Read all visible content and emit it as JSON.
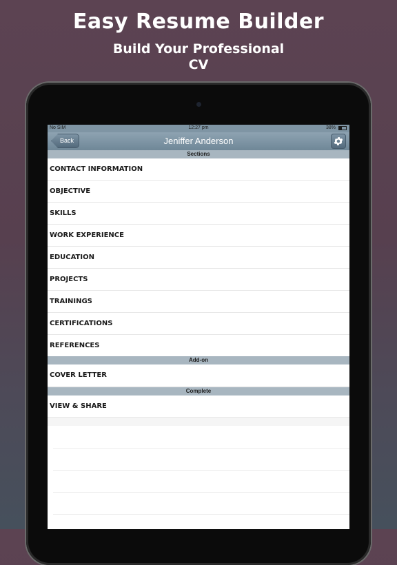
{
  "promo": {
    "title": "Easy Resume Builder",
    "subtitle": "Build Your Professional CV"
  },
  "status_bar": {
    "carrier": "No SIM",
    "time": "12:27 pm",
    "battery": "38%",
    "battery_level": 0.38
  },
  "nav": {
    "back_label": "Back",
    "title": "Jeniffer Anderson",
    "settings_icon": "gear-icon"
  },
  "sections": {
    "header": "Sections",
    "items": [
      "CONTACT INFORMATION",
      "OBJECTIVE",
      "SKILLS",
      "WORK EXPERIENCE",
      "EDUCATION",
      "PROJECTS",
      "TRAININGS",
      "CERTIFICATIONS",
      "REFERENCES"
    ]
  },
  "addon": {
    "header": "Add-on",
    "items": [
      "COVER LETTER"
    ]
  },
  "complete": {
    "header": "Complete",
    "items": [
      "VIEW & SHARE"
    ]
  },
  "colors": {
    "navbar": "#7f95a4",
    "section_header": "#a8b6c0",
    "background_top": "#5c4352",
    "background_bottom": "#46505c"
  }
}
